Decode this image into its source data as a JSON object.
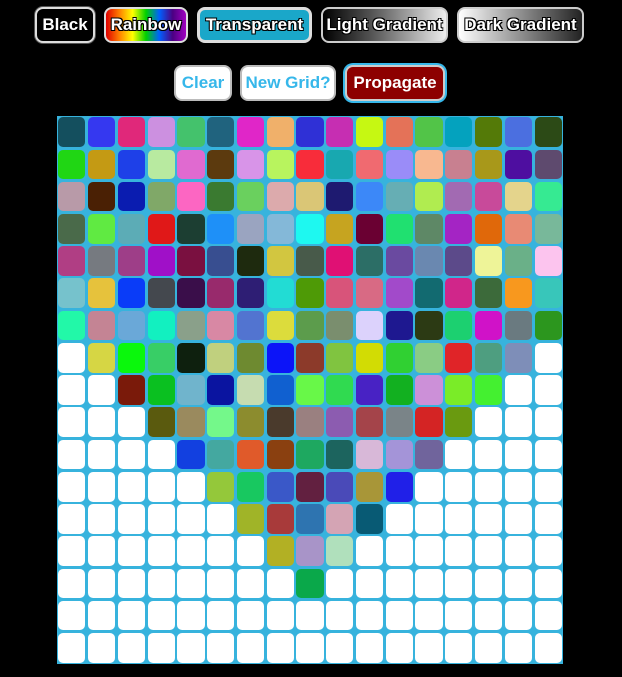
{
  "toolbar": {
    "black_label": "Black",
    "rainbow_label": "Rainbow",
    "transparent_label": "Transparent",
    "light_gradient_label": "Light Gradient",
    "dark_gradient_label": "Dark Gradient",
    "clear_label": "Clear",
    "new_grid_label": "New Grid?",
    "propagate_label": "Propagate"
  },
  "colors": {
    "grid_line": "#37b3dd",
    "empty_cell": "#ffffff",
    "propagate_bg": "#8d0000",
    "accent_text": "#36b7ea"
  },
  "grid": {
    "cols": 17,
    "rows": 17,
    "cells": [
      [
        "#144f5e",
        "#3538f0",
        "#e0287a",
        "#cc90e0",
        "#44c26c",
        "#20637e",
        "#e026c8",
        "#f0b06a",
        "#2f30d6",
        "#c62eb2",
        "#c6f812",
        "#e47258",
        "#52c448",
        "#04a2be",
        "#547a08",
        "#4b6fe0",
        "#2c4a16"
      ],
      [
        "#20d614",
        "#c49a14",
        "#1e40e8",
        "#b8eaa0",
        "#e06ad0",
        "#5c3a0e",
        "#d894e8",
        "#b8f45e",
        "#f82c3a",
        "#18a8b0",
        "#f06a70",
        "#9a8cf8",
        "#f8b890",
        "#c88090",
        "#a8981a",
        "#4e0ea0",
        "#5e4a6e"
      ],
      [
        "#b89aa8",
        "#4a2004",
        "#0a1cb0",
        "#80a868",
        "#fc66c2",
        "#3a7a30",
        "#6ad05e",
        "#dcaaac",
        "#dac676",
        "#1e1a70",
        "#3c88f8",
        "#66aeb4",
        "#b0ec50",
        "#a26ab2",
        "#c84a9a",
        "#e4d48c",
        "#36ea92"
      ],
      [
        "#4a6a4a",
        "#60ea42",
        "#5cacb6",
        "#e01818",
        "#1c3e32",
        "#1e90f8",
        "#9aa4c0",
        "#84b8d8",
        "#1ef8f0",
        "#c6a420",
        "#6a0032",
        "#20e070",
        "#5e8866",
        "#a424c4",
        "#e0680a",
        "#e88a74",
        "#78b89a"
      ],
      [
        "#b03e84",
        "#767a80",
        "#9e3e88",
        "#a010c8",
        "#7a1040",
        "#384e90",
        "#1e2a0e",
        "#d2c640",
        "#485a4a",
        "#e01074",
        "#2c6e66",
        "#6a4aa0",
        "#6a88b0",
        "#5c4a8a",
        "#eef498",
        "#6ab088",
        "#fcc4ee"
      ],
      [
        "#76c2cc",
        "#e6c23c",
        "#0a3cf8",
        "#44484e",
        "#3a0e4a",
        "#982a6c",
        "#2e1e74",
        "#22dcd4",
        "#4e9a06",
        "#d8547a",
        "#d86a84",
        "#a24aca",
        "#126a70",
        "#d0268a",
        "#3c6a3a",
        "#f8981e",
        "#38c6ba"
      ],
      [
        "#22f8a8",
        "#c48494",
        "#6aa8d8",
        "#12f0c0",
        "#8aa08a",
        "#d888a4",
        "#5274d0",
        "#dcdc3c",
        "#5c9c4c",
        "#7a8e6e",
        "#dcd2fc",
        "#1e1890",
        "#2c3a14",
        "#1cd070",
        "#d012c8",
        "#6a7a80",
        "#2c961e"
      ],
      [
        "#ffffff",
        "#d6d644",
        "#0af80c",
        "#38ce66",
        "#0e200e",
        "#c0d07e",
        "#6e8a30",
        "#0c14f8",
        "#8c3a2a",
        "#80c440",
        "#d2dc04",
        "#30d032",
        "#8acc84",
        "#e02428",
        "#4e9e80",
        "#7e8eb8",
        "#ffffff"
      ],
      [
        "#ffffff",
        "#ffffff",
        "#7a1a0a",
        "#0ac020",
        "#70b4cc",
        "#0a14a0",
        "#c6dcb0",
        "#1060d0",
        "#68f848",
        "#30da50",
        "#4822c4",
        "#12b020",
        "#cc90d8",
        "#7aec28",
        "#44f030",
        "#ffffff",
        "#ffffff"
      ],
      [
        "#ffffff",
        "#ffffff",
        "#ffffff",
        "#5a5a0e",
        "#9a8a5e",
        "#74f88a",
        "#8c8c2e",
        "#4a3a2c",
        "#9a8080",
        "#8c5cb0",
        "#a4444a",
        "#7a8488",
        "#d42424",
        "#6a9a10",
        "#ffffff",
        "#ffffff",
        "#ffffff"
      ],
      [
        "#ffffff",
        "#ffffff",
        "#ffffff",
        "#ffffff",
        "#1240e0",
        "#44a8a0",
        "#e05a2a",
        "#8a4010",
        "#1ea860",
        "#1c645e",
        "#d8b8d8",
        "#a494d8",
        "#70649c",
        "#ffffff",
        "#ffffff",
        "#ffffff",
        "#ffffff"
      ],
      [
        "#ffffff",
        "#ffffff",
        "#ffffff",
        "#ffffff",
        "#ffffff",
        "#94c83a",
        "#18c860",
        "#3a58c8",
        "#622040",
        "#4a4ab8",
        "#a89638",
        "#2020e8",
        "#ffffff",
        "#ffffff",
        "#ffffff",
        "#ffffff",
        "#ffffff"
      ],
      [
        "#ffffff",
        "#ffffff",
        "#ffffff",
        "#ffffff",
        "#ffffff",
        "#ffffff",
        "#a0b428",
        "#a83a3a",
        "#2e74b0",
        "#d4a4b4",
        "#085a74",
        "#ffffff",
        "#ffffff",
        "#ffffff",
        "#ffffff",
        "#ffffff",
        "#ffffff"
      ],
      [
        "#ffffff",
        "#ffffff",
        "#ffffff",
        "#ffffff",
        "#ffffff",
        "#ffffff",
        "#ffffff",
        "#b2b024",
        "#a894c8",
        "#b0e0bc",
        "#ffffff",
        "#ffffff",
        "#ffffff",
        "#ffffff",
        "#ffffff",
        "#ffffff",
        "#ffffff"
      ],
      [
        "#ffffff",
        "#ffffff",
        "#ffffff",
        "#ffffff",
        "#ffffff",
        "#ffffff",
        "#ffffff",
        "#ffffff",
        "#0aa84a",
        "#ffffff",
        "#ffffff",
        "#ffffff",
        "#ffffff",
        "#ffffff",
        "#ffffff",
        "#ffffff",
        "#ffffff"
      ],
      [
        "#ffffff",
        "#ffffff",
        "#ffffff",
        "#ffffff",
        "#ffffff",
        "#ffffff",
        "#ffffff",
        "#ffffff",
        "#ffffff",
        "#ffffff",
        "#ffffff",
        "#ffffff",
        "#ffffff",
        "#ffffff",
        "#ffffff",
        "#ffffff",
        "#ffffff"
      ],
      [
        "#ffffff",
        "#ffffff",
        "#ffffff",
        "#ffffff",
        "#ffffff",
        "#ffffff",
        "#ffffff",
        "#ffffff",
        "#ffffff",
        "#ffffff",
        "#ffffff",
        "#ffffff",
        "#ffffff",
        "#ffffff",
        "#ffffff",
        "#ffffff",
        "#ffffff"
      ]
    ]
  }
}
